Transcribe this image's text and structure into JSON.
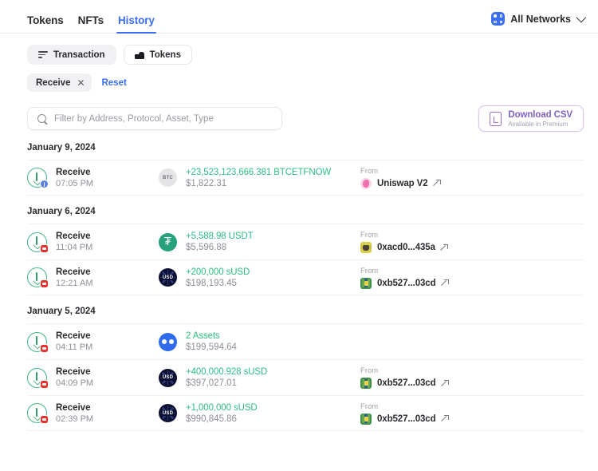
{
  "header": {
    "tabs": [
      {
        "label": "Tokens",
        "active": false
      },
      {
        "label": "NFTs",
        "active": false
      },
      {
        "label": "History",
        "active": true
      }
    ],
    "network_selector": {
      "label": "All Networks",
      "icon": "networks-grid-icon",
      "chevron": "chevron-down-icon"
    }
  },
  "filters": {
    "pills": [
      {
        "label": "Transaction",
        "icon": "filter-lines-icon",
        "selected": true
      },
      {
        "label": "Tokens",
        "icon": "coins-icon",
        "selected": false
      }
    ],
    "active_chips": [
      {
        "label": "Receive",
        "remove_icon": "close-icon"
      }
    ],
    "reset_label": "Reset"
  },
  "search": {
    "placeholder": "Filter by Address, Protocol, Asset, Type",
    "value": "",
    "icon": "search-icon"
  },
  "download_csv": {
    "title": "Download CSV",
    "subtitle": "Available in Premium",
    "icon": "file-download-icon"
  },
  "colors": {
    "accent_blue": "#3b6ef5",
    "amount_green": "#2ebd85",
    "receive_ring": "#41b883",
    "premium_purple": "#7e63c4",
    "usdt_green": "#26a17b",
    "susd_navy": "#0b1033",
    "multi_blue": "#2f6bec",
    "optimism_red": "#e8322e"
  },
  "groups": [
    {
      "date": "January 9, 2024",
      "rows": [
        {
          "type": "Receive",
          "time": "07:05 PM",
          "chain_badge": "bitcoin-badge-icon",
          "token_icon": "btc-token-icon",
          "token_symbol": "BTC",
          "amount": "+23,523,123,666.381 BTCETFNOW",
          "value": "$1,822.31",
          "from_label": "From",
          "from_value": "Uniswap V2",
          "from_avatar": "uniswap-logo-icon",
          "external_icon": "external-link-icon"
        }
      ]
    },
    {
      "date": "January 6, 2024",
      "rows": [
        {
          "type": "Receive",
          "time": "11:04 PM",
          "chain_badge": "optimism-badge-icon",
          "token_icon": "usdt-token-icon",
          "token_symbol": "USDT",
          "amount": "+5,588.98 USDT",
          "value": "$5,596.88",
          "from_label": "From",
          "from_value": "0xacd0...435a",
          "from_avatar": "address-avatar-olive",
          "external_icon": "external-link-icon"
        },
        {
          "type": "Receive",
          "time": "12:21 AM",
          "chain_badge": "optimism-badge-icon",
          "token_icon": "susd-token-icon",
          "token_symbol": "sUSD",
          "amount": "+200,000 sUSD",
          "value": "$198,193.45",
          "from_label": "From",
          "from_value": "0xb527...03cd",
          "from_avatar": "address-avatar-green",
          "external_icon": "external-link-icon"
        }
      ]
    },
    {
      "date": "January 5, 2024",
      "rows": [
        {
          "type": "Receive",
          "time": "04:11 PM",
          "chain_badge": "optimism-badge-icon",
          "token_icon": "multi-asset-icon",
          "token_symbol": "",
          "amount": "2 Assets",
          "value": "$199,594.64",
          "from_label": "",
          "from_value": "",
          "from_avatar": "",
          "external_icon": ""
        },
        {
          "type": "Receive",
          "time": "04:09 PM",
          "chain_badge": "optimism-badge-icon",
          "token_icon": "susd-token-icon",
          "token_symbol": "sUSD",
          "amount": "+400,000.928 sUSD",
          "value": "$397,027.01",
          "from_label": "From",
          "from_value": "0xb527...03cd",
          "from_avatar": "address-avatar-green",
          "external_icon": "external-link-icon"
        },
        {
          "type": "Receive",
          "time": "02:39 PM",
          "chain_badge": "optimism-badge-icon",
          "token_icon": "susd-token-icon",
          "token_symbol": "sUSD",
          "amount": "+1,000,000 sUSD",
          "value": "$990,845.86",
          "from_label": "From",
          "from_value": "0xb527...03cd",
          "from_avatar": "address-avatar-green",
          "external_icon": "external-link-icon"
        }
      ]
    }
  ]
}
